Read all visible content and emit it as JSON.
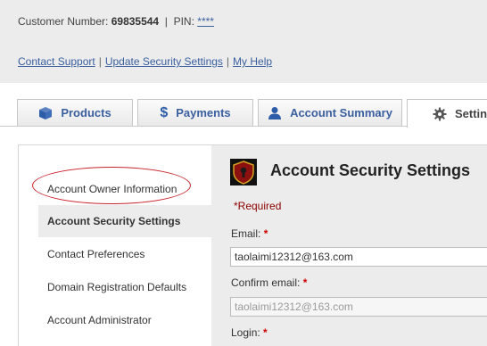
{
  "header": {
    "customer_label": "Customer Number:",
    "customer_number": "69835544",
    "pin_label": "PIN:",
    "pin_value": "****",
    "links": [
      "Contact Support",
      "Update Security Settings",
      "My Help"
    ]
  },
  "tabs": [
    {
      "label": "Products",
      "icon": "box-icon"
    },
    {
      "label": "Payments",
      "icon": "dollar-icon"
    },
    {
      "label": "Account Summary",
      "icon": "person-icon"
    },
    {
      "label": "Settin",
      "icon": "gear-icon"
    }
  ],
  "sidebar": {
    "items": [
      {
        "label": "Account Owner Information"
      },
      {
        "label": "Account Security Settings"
      },
      {
        "label": "Contact Preferences"
      },
      {
        "label": "Domain Registration Defaults"
      },
      {
        "label": "Account Administrator"
      }
    ]
  },
  "main": {
    "title": "Account Security Settings",
    "required_note": "*Required",
    "fields": [
      {
        "label": "Email:",
        "star": "*",
        "value": "taolaimi12312@163.com"
      },
      {
        "label": "Confirm email:",
        "star": "*",
        "value": "taolaimi12312@163.com"
      },
      {
        "label": "Login:",
        "star": "*"
      }
    ]
  },
  "colors": {
    "link": "#3a5f9f",
    "highlight_ellipse": "#c8232c",
    "required": "#8b0000"
  }
}
